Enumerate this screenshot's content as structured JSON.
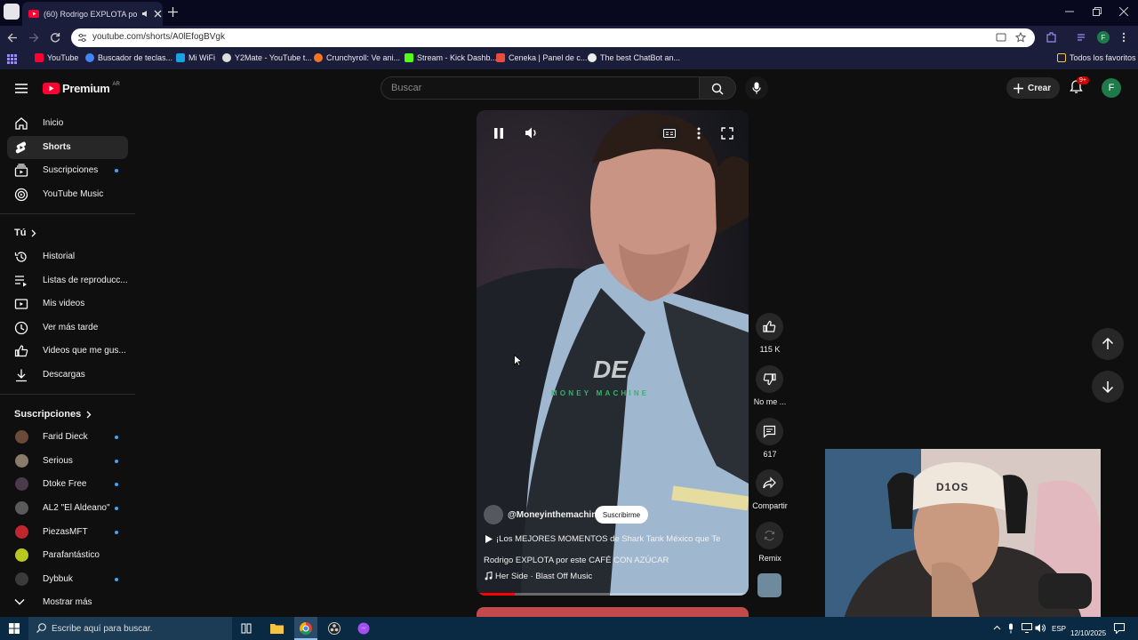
{
  "browser": {
    "tab_title": "(60) Rodrigo EXPLOTA por",
    "url": "youtube.com/shorts/A0lEfogBVgk",
    "bookmarks": [
      "YouTube",
      "Buscador de teclas...",
      "Mi WiFi",
      "Y2Mate - YouTube t...",
      "Crunchyroll: Ve ani...",
      "Stream - Kick Dashb...",
      "Ceneka | Panel de c...",
      "The best ChatBot an..."
    ],
    "bookmarks_folder": "Todos los favoritos",
    "profile_letter": "F"
  },
  "youtube": {
    "logo_text": "Premium",
    "country": "AR",
    "search_placeholder": "Buscar",
    "create_label": "Crear",
    "notif_count": "9+",
    "avatar_letter": "F"
  },
  "sidebar": {
    "main": [
      {
        "label": "Inicio",
        "icon": "home-icon"
      },
      {
        "label": "Shorts",
        "icon": "shorts-icon",
        "active": true
      },
      {
        "label": "Suscripciones",
        "icon": "subscriptions-icon",
        "dot": true
      },
      {
        "label": "YouTube Music",
        "icon": "music-icon"
      }
    ],
    "you_header": "Tú",
    "you": [
      {
        "label": "Historial",
        "icon": "history-icon"
      },
      {
        "label": "Listas de reproducc...",
        "icon": "playlist-icon"
      },
      {
        "label": "Mis videos",
        "icon": "my-videos-icon"
      },
      {
        "label": "Ver más tarde",
        "icon": "watch-later-icon"
      },
      {
        "label": "Videos que me gus...",
        "icon": "liked-icon"
      },
      {
        "label": "Descargas",
        "icon": "download-icon"
      }
    ],
    "subs_header": "Suscripciones",
    "subs": [
      {
        "label": "Farid Dieck",
        "color": "#6b4a3a"
      },
      {
        "label": "Serious",
        "color": "#8a7a6a"
      },
      {
        "label": "Dtoke Free",
        "color": "#4a3a4a"
      },
      {
        "label": "AL2 \"El Aldeano\"",
        "color": "#5a5a5a"
      },
      {
        "label": "PiezasMFT",
        "color": "#c0272d"
      },
      {
        "label": "Parafantástico",
        "color": "#b8c81e"
      },
      {
        "label": "Dybbuk",
        "color": "#3a3a3a"
      }
    ],
    "show_more": "Mostrar más"
  },
  "short": {
    "watermark_big": "DE",
    "watermark_small": "MONEY MACHINE",
    "channel": "@Moneyinthemachine",
    "subscribe": "Suscribirme",
    "title_line1": "¡Los MEJORES MOMENTOS de Shark Tank México que Te",
    "title_line2": "Rodrigo EXPLOTA por este CAFÉ CON AZÚCAR",
    "music": "Her Side · Blast Off Music",
    "likes": "115 K",
    "dislike": "No me ...",
    "comments": "617",
    "share": "Compartir",
    "remix": "Remix"
  },
  "taskbar": {
    "search_placeholder": "Escribe aquí para buscar.",
    "lang": "ESP",
    "date": "12/10/2025"
  },
  "webcam": {
    "cap_text": "D1OS"
  }
}
